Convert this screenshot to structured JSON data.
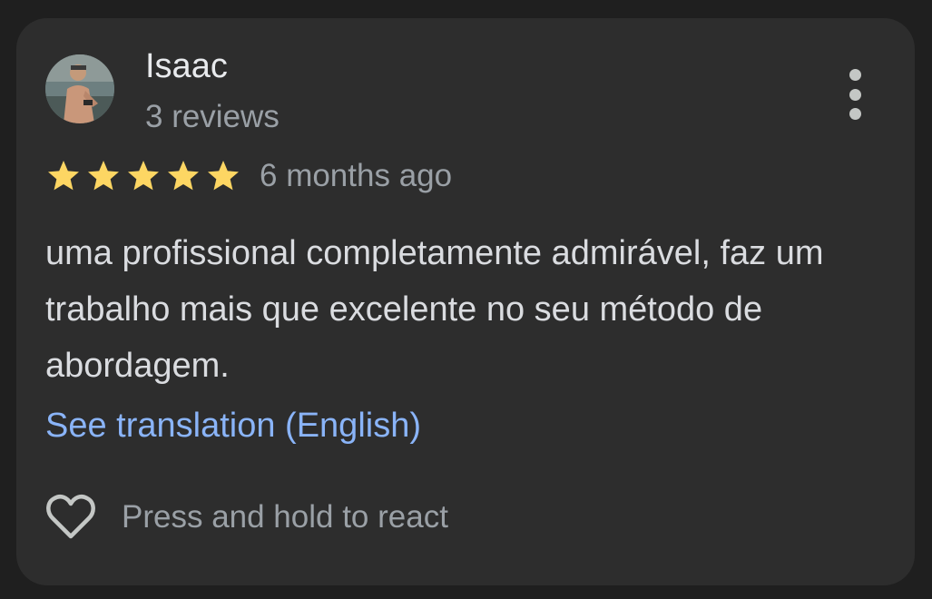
{
  "review": {
    "author": {
      "name": "Isaac",
      "review_count": "3 reviews",
      "avatar_icon": "user-avatar-photo"
    },
    "rating": {
      "stars": 5,
      "max_stars": 5,
      "star_color": "#fdd663",
      "star_icon": "star-icon"
    },
    "time_ago": "6 months ago",
    "text": "uma profissional completamente admirável, faz um trabalho mais que excelente no seu método de abordagem.",
    "translation_link": "See translation (English)",
    "react_prompt": "Press and hold to react",
    "react_icon": "heart-outline-icon",
    "menu_icon": "more-vertical-icon"
  },
  "colors": {
    "background": "#1f1f1f",
    "card": "#2d2d2d",
    "primary_text": "#e8eaed",
    "secondary_text": "#9aa0a6",
    "link": "#8ab4f8"
  }
}
